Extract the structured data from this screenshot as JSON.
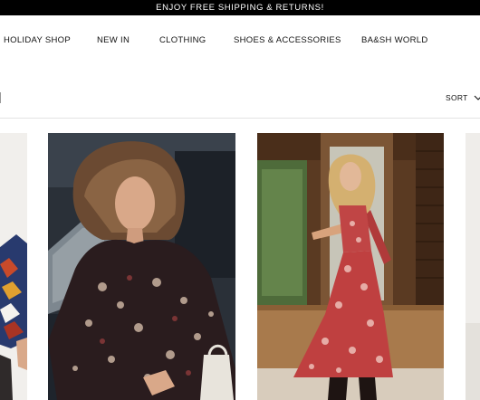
{
  "promo": {
    "text": "ENJOY FREE SHIPPING & RETURNS!"
  },
  "nav": {
    "items": [
      {
        "label": "HOLIDAY SHOP"
      },
      {
        "label": "NEW IN"
      },
      {
        "label": "CLOTHING"
      },
      {
        "label": "SHOES & ACCESSORIES"
      },
      {
        "label": "BA&SH WORLD"
      }
    ]
  },
  "toolbar": {
    "sort_label": "SORT"
  },
  "products": [
    {
      "image": "model-in-patterned-top-partial"
    },
    {
      "image": "model-in-floral-print-blouse-in-car"
    },
    {
      "image": "model-in-red-print-dress-by-window"
    },
    {
      "image": "product-image-partial"
    }
  ],
  "colors": {
    "promo_bg": "#000000",
    "promo_text": "#ffffff",
    "text": "#111111",
    "divider": "#e3e3e3"
  }
}
